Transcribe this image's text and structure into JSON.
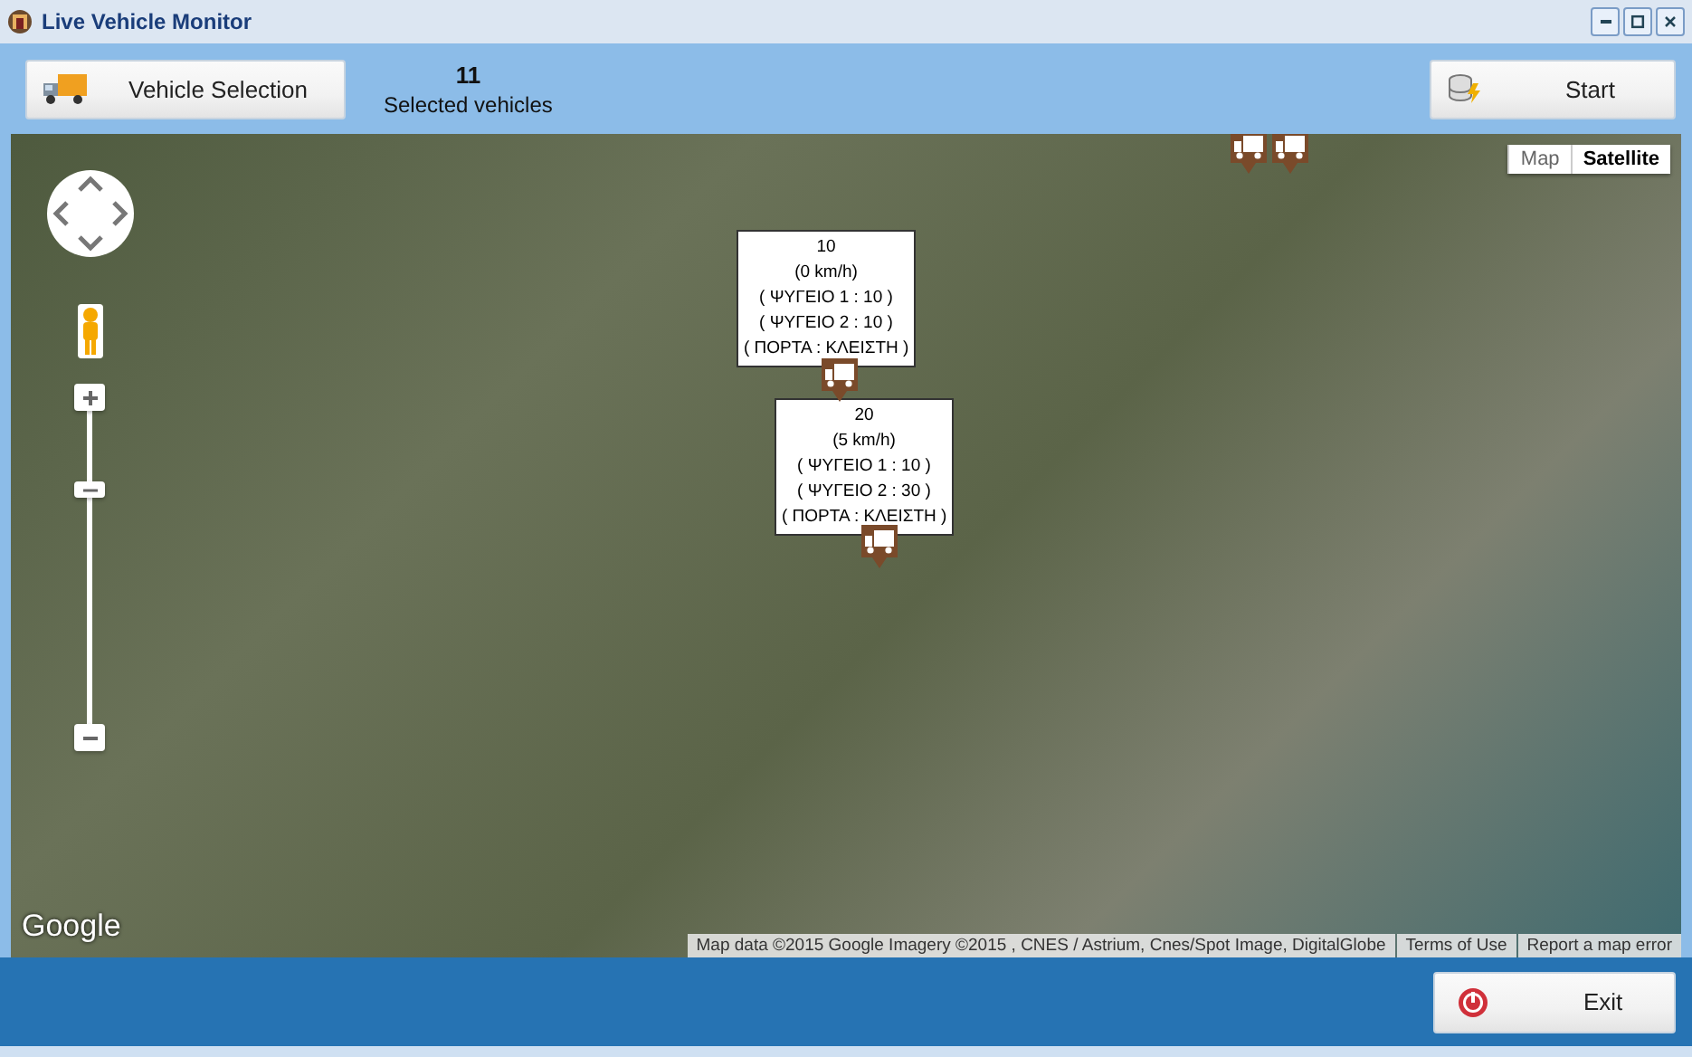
{
  "window": {
    "title": "Live Vehicle Monitor"
  },
  "toolbar": {
    "vehicle_button": "Vehicle Selection",
    "selected_count": "11",
    "selected_label": "Selected vehicles",
    "start_button": "Start"
  },
  "map": {
    "map_types": [
      {
        "label": "Map",
        "selected": false
      },
      {
        "label": "Satellite",
        "selected": true
      }
    ],
    "popups": [
      {
        "lines": [
          "10",
          "(0 km/h)",
          "( ΨΥΓΕΙΟ 1 : 10 )",
          "( ΨΥΓΕΙΟ 2 : 10 )",
          "( ΠΟΡΤΑ : ΚΛΕΙΣΤΗ )"
        ]
      },
      {
        "lines": [
          "20",
          "(5 km/h)",
          "( ΨΥΓΕΙΟ 1 : 10 )",
          "( ΨΥΓΕΙΟ 2 : 30 )",
          "( ΠΟΡΤΑ : ΚΛΕΙΣΤΗ )"
        ]
      }
    ],
    "logo": "Google",
    "attribution": [
      "Map data ©2015 Google Imagery ©2015 , CNES / Astrium, Cnes/Spot Image, DigitalGlobe",
      "Terms of Use",
      "Report a map error"
    ]
  },
  "footer": {
    "exit_button": "Exit"
  }
}
